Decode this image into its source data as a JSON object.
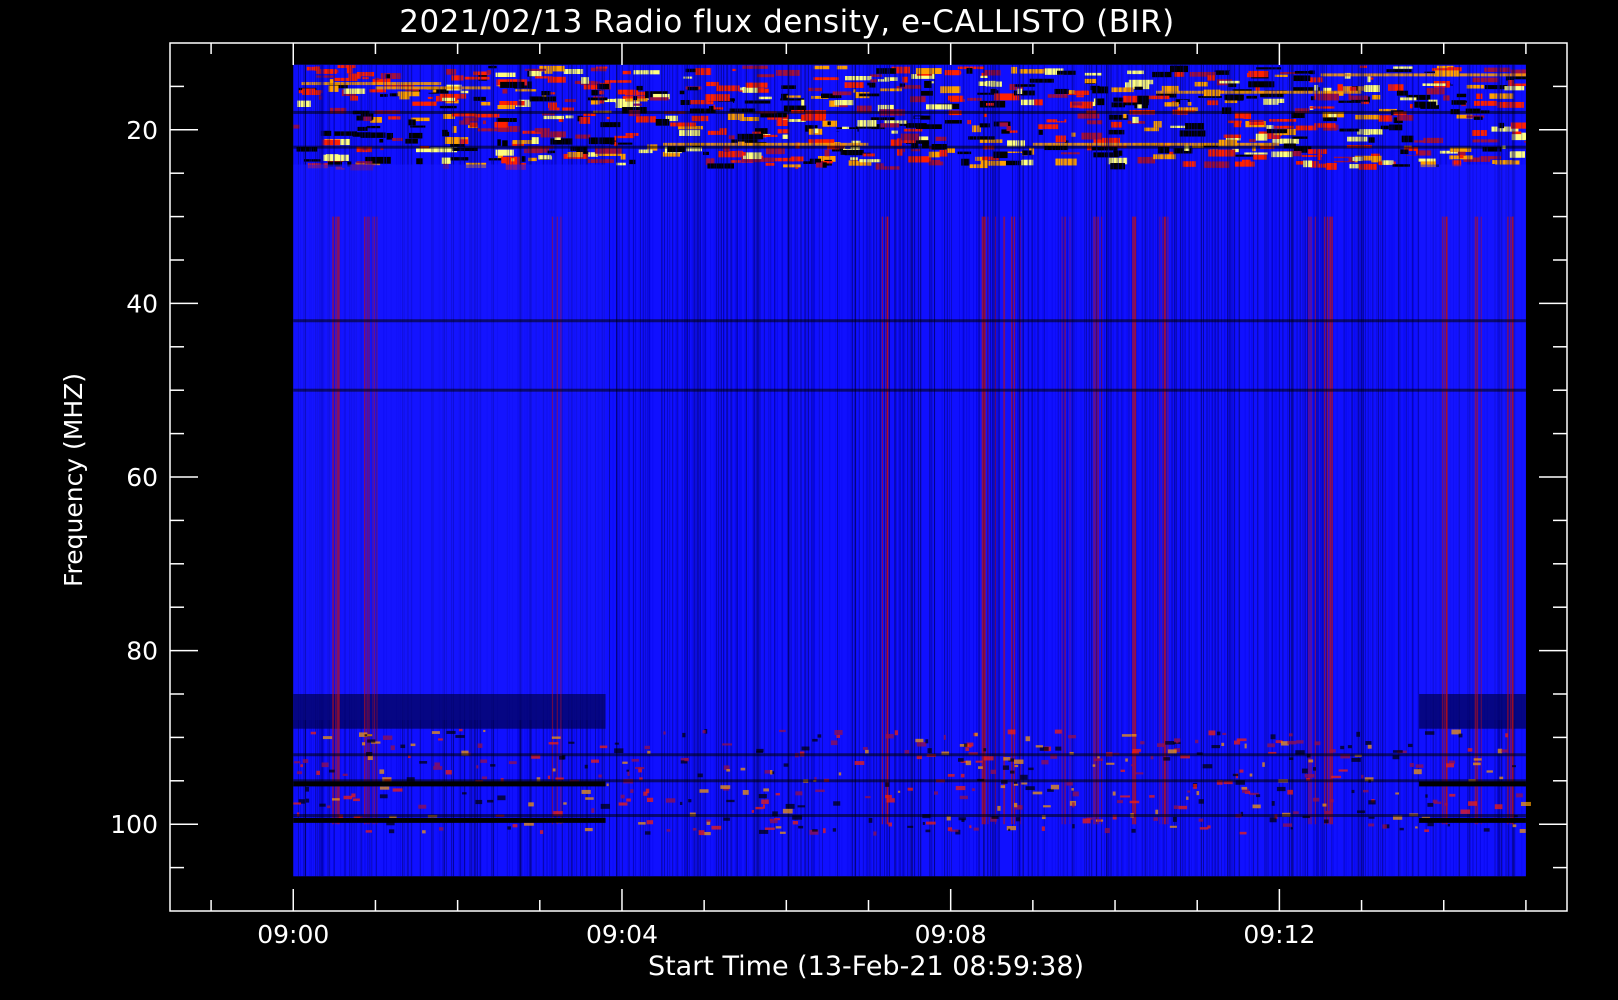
{
  "chart_data": {
    "type": "heatmap",
    "title": "2021/02/13  Radio flux density, e-CALLISTO (BIR)",
    "xlabel": "Start Time (13-Feb-21 08:59:38)",
    "ylabel": "Frequency (MHZ)",
    "x_axis": {
      "unit": "minutes since 09:00",
      "range": [
        -1.5,
        15.5
      ],
      "data_range": [
        0,
        15
      ],
      "major_ticks": [
        0,
        4,
        8,
        12
      ],
      "tick_labels": [
        "09:00",
        "09:04",
        "09:08",
        "09:12"
      ],
      "minor_step": 1
    },
    "y_axis": {
      "unit": "MHz",
      "range": [
        10,
        110
      ],
      "inverted": true,
      "data_range": [
        12.5,
        106
      ],
      "major_ticks": [
        20,
        40,
        60,
        80,
        100
      ],
      "tick_labels": [
        "20",
        "40",
        "60",
        "80",
        "100"
      ],
      "minor_step": 5
    },
    "colormap": [
      "#000000",
      "#1010ff",
      "#a01040",
      "#ff2000",
      "#ffa000",
      "#ffff80"
    ],
    "background_intensity": "blue",
    "features": [
      {
        "name": "high-intensity bands",
        "freq_range_mhz": [
          12.5,
          24
        ],
        "time_range_min": [
          0,
          15
        ],
        "color": "#ff8000"
      },
      {
        "name": "interference band",
        "freq_range_mhz": [
          89,
          101
        ],
        "time_range_min": [
          0,
          15
        ],
        "color": "#ff4000"
      },
      {
        "name": "vertical bursts",
        "freq_range_mhz": [
          30,
          100
        ],
        "times_min": [
          0.5,
          0.9,
          1.0,
          3.2,
          7.2,
          8.4,
          8.6,
          8.8,
          9.4,
          9.8,
          10.2,
          10.6,
          12.4,
          12.6,
          14.0,
          14.4,
          14.8
        ],
        "color": "#c01010"
      },
      {
        "name": "dark horizontal lines",
        "freq_mhz": [
          18,
          22,
          42,
          50,
          92,
          95,
          99
        ],
        "color": "#000000"
      }
    ]
  }
}
